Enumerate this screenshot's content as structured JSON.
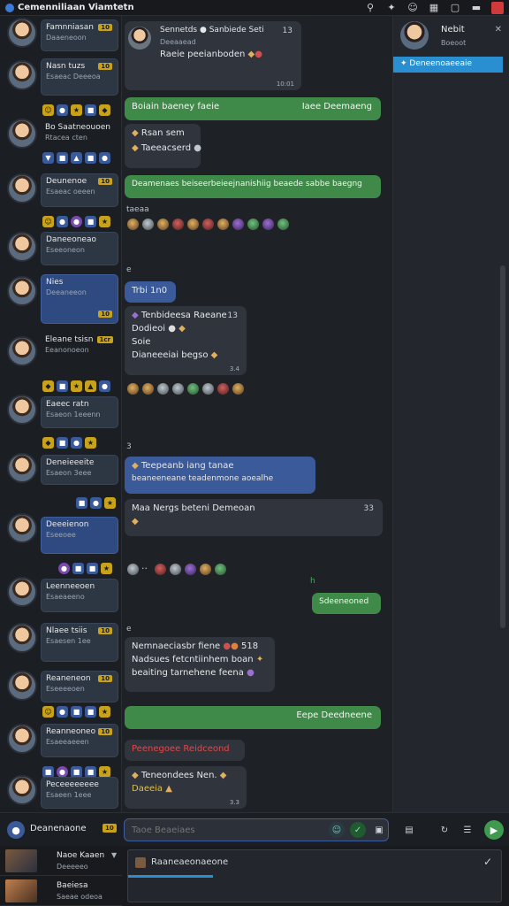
{
  "window": {
    "title": "Cemenniliaan Viamtetn"
  },
  "left_list": [
    {
      "name": "Famnniasan",
      "sub": "Daaeneoon",
      "badge": "10"
    },
    {
      "name": "Nasn tuzs",
      "sub": "Esaeac Deeeoa",
      "badge": "10"
    },
    {
      "name": "Bo Saatneouoen",
      "sub": "Rtacea cten"
    },
    {
      "name": "Deunenoe",
      "sub": "Esaeac oeeen",
      "badge": "10"
    },
    {
      "name": "Daneeoneao",
      "sub": "Eseeoneon"
    },
    {
      "name": "Nies",
      "sub": "Deeaneeon",
      "badge": "10"
    },
    {
      "name": "Eleane tsisn",
      "sub": "Eeanonoeon",
      "badge": "1cr"
    },
    {
      "name": "Eaeec ratn",
      "sub": "Esaeon 1eeenn"
    },
    {
      "name": "Deneieeeite",
      "sub": "Esaeon 3eee"
    },
    {
      "name": "Deeeienon",
      "sub": "Eseeoee"
    },
    {
      "name": "Leenneeoen",
      "sub": "Esaeaeeno"
    },
    {
      "name": "Nlaee tsiis",
      "sub": "Esaesen 1ee",
      "badge": "10"
    },
    {
      "name": "Reaneneon",
      "sub": "Eseeeeoen",
      "badge": "10"
    },
    {
      "name": "Reanneoneo",
      "sub": "Esaeeaeeen",
      "badge": "10"
    },
    {
      "name": "Peceeeeeeee",
      "sub": "Esaeen 1eee"
    }
  ],
  "messages": [
    {
      "author": "Sennetds",
      "author2": "Sanbiede Seti",
      "num": "13",
      "sub": "Deeaaead",
      "body": "Raeie peeianboden",
      "time": "10:01"
    },
    {
      "left": "Boiain baeney faeie",
      "right": "Iaee Deemaeng"
    },
    {
      "title": "Rsan sem",
      "sub": "Taeeacserd"
    },
    {
      "text": "Deamenaes beiseerbeieejnanishiig beaede sabbe baegng"
    },
    {
      "label": "taeaa"
    },
    {
      "label": "e"
    },
    {
      "text": "Trbi 1n0"
    },
    {
      "title": "Tenbideesa Raeane",
      "num": "13",
      "l2": "Dodieoi",
      "l3": "Soie",
      "l4": "Dianeeeiai begso",
      "time": "3.4"
    },
    {
      "label": "3"
    },
    {
      "title": "Teepeanb iang tanae",
      "body": "beaneeneane teadenmone aoealhe"
    },
    {
      "title": "Maa Nergs beteni Demeoan",
      "num": "33"
    },
    {
      "label": "h"
    },
    {
      "text": "Sdeeneoned"
    },
    {
      "label": "e"
    },
    {
      "l1": "Nemnaeciasbr fiene",
      "num": "518",
      "l2": "Nadsues fetcntiinhem boan",
      "l3": "beaiting tarnehene feena"
    },
    {
      "text": "Eepe Deedneene"
    },
    {
      "text": "Peenegoee Reidceond"
    },
    {
      "title": "Teneondees Nen.",
      "l2": "Daeeia",
      "time": "3.3"
    }
  ],
  "right_panel": {
    "name": "Nebit",
    "sub": "Boeoot",
    "selected": "Deneenoaeeaie"
  },
  "composer": {
    "user": "Deanenaone",
    "badge": "10",
    "placeholder": "Taoe Beaeiaes"
  },
  "bottom_list": [
    {
      "name": "Naoe Kaaen",
      "sub": "Deeeeeo"
    },
    {
      "name": "Baeiesa",
      "sub": "Saeae odeoa"
    }
  ],
  "editor": {
    "title": "Raaneaeonaeone"
  },
  "colors": {
    "accent": "#3a5a9a",
    "green": "#3f8a48",
    "badge": "#c9a21c",
    "selected": "#2a8fd0"
  }
}
